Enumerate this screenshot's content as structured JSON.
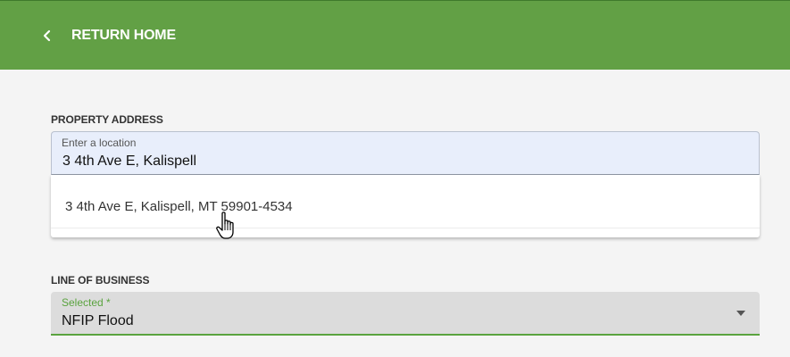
{
  "header": {
    "back_label": "RETURN HOME",
    "back_icon": "chevron-left-icon",
    "background_color": "#62a045"
  },
  "address": {
    "section_label": "PROPERTY ADDRESS",
    "field_label": "Enter a location",
    "value": "3 4th Ave E, Kalispell",
    "suggestions": [
      {
        "text": "3 4th Ave E, Kalispell, MT 59901-4534"
      }
    ]
  },
  "line_of_business": {
    "section_label": "LINE OF BUSINESS",
    "field_label": "Selected *",
    "selected": "NFIP Flood",
    "caret_icon": "dropdown-caret-icon",
    "accent_color": "#5aa33f"
  }
}
